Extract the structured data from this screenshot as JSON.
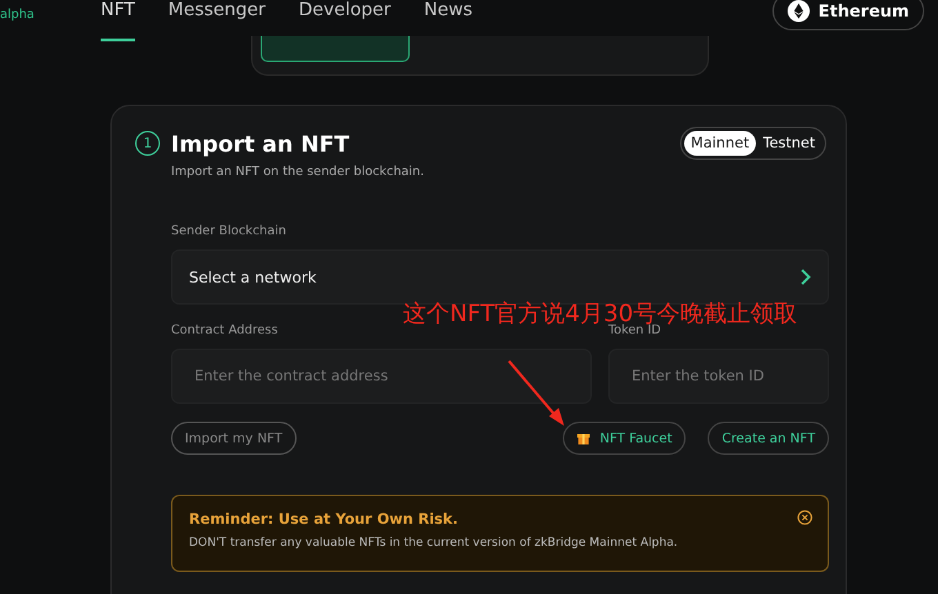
{
  "logo": {
    "text": "alpha"
  },
  "nav": [
    {
      "label": "NFT",
      "selected": true
    },
    {
      "label": "Messenger",
      "selected": false
    },
    {
      "label": "Developer",
      "selected": false
    },
    {
      "label": "News",
      "selected": false
    }
  ],
  "network_button": {
    "label": "Ethereum"
  },
  "card": {
    "step": "1",
    "title": "Import an NFT",
    "subtitle": "Import an NFT on the sender blockchain.",
    "network_toggle": [
      {
        "label": "Mainnet",
        "selected": true
      },
      {
        "label": "Testnet",
        "selected": false
      }
    ],
    "sender_label": "Sender Blockchain",
    "sender_select": "Select a network",
    "contract_label": "Contract Address",
    "contract_placeholder": "Enter the contract address",
    "token_label": "Token ID",
    "token_placeholder": "Enter the token ID",
    "buttons": [
      {
        "label": "Import my NFT",
        "kind": "muted"
      },
      {
        "label": "NFT Faucet",
        "kind": "gift"
      },
      {
        "label": "Create an NFT",
        "kind": "accent"
      }
    ],
    "reminder": {
      "title": "Reminder: Use at Your Own Risk.",
      "text": "DON'T transfer any valuable NFTs in the current version of zkBridge Mainnet Alpha."
    }
  },
  "annotation": {
    "text": "这个NFT官方说4月30号今晚截止领取"
  }
}
